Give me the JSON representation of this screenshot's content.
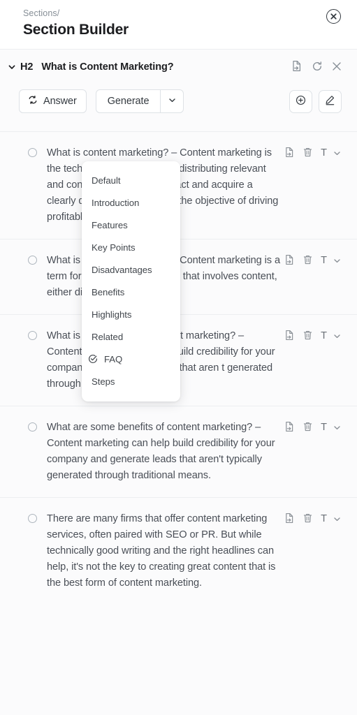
{
  "header": {
    "breadcrumb": "Sections/",
    "title": "Section Builder",
    "close_icon": "close-circle-icon"
  },
  "section": {
    "collapse_icon": "chevron-down-icon",
    "level": "H2",
    "title": "What is Content Marketing?",
    "actions": [
      {
        "icon": "export-document-icon",
        "name": "export-section-button"
      },
      {
        "icon": "refresh-icon",
        "name": "regenerate-section-button"
      },
      {
        "icon": "close-icon",
        "name": "remove-section-button"
      }
    ]
  },
  "toolbar": {
    "answer_label": "Answer",
    "answer_icon": "cycle-refresh-icon",
    "generate_label": "Generate",
    "generate_caret_icon": "chevron-down-icon",
    "add_icon": "plus-circle-icon",
    "edit_icon": "pencil-icon"
  },
  "dropdown": {
    "open": true,
    "selected": "FAQ",
    "check_icon": "check-circle-icon",
    "items": [
      {
        "label": "Default",
        "checked": false
      },
      {
        "label": "Introduction",
        "checked": false
      },
      {
        "label": "Features",
        "checked": false
      },
      {
        "label": "Key Points",
        "checked": false
      },
      {
        "label": "Disadvantages",
        "checked": false
      },
      {
        "label": "Benefits",
        "checked": false
      },
      {
        "label": "Highlights",
        "checked": false
      },
      {
        "label": "Related",
        "checked": false
      },
      {
        "label": "FAQ",
        "checked": true
      },
      {
        "label": "Steps",
        "checked": false
      }
    ]
  },
  "row_actions": {
    "export_icon": "export-document-icon",
    "delete_icon": "trash-icon",
    "text_style_label": "T",
    "text_style_caret_icon": "chevron-down-icon"
  },
  "items": [
    {
      "text": "What is content marketing? – Content marketing is the technique of creating and distributing relevant and consistent content to attract and acquire a clearly defined audience with the objective of driving profitable customer action.",
      "selected": false
    },
    {
      "text": "What is content marketing? – Content marketing is a term for any type of marketing that involves content, either digital or physical.",
      "selected": false
    },
    {
      "text": "What is the purpose of content marketing? – Content marketing can help build credibility for your company and generate leads that aren t generated through traditional methods.",
      "selected": false
    },
    {
      "text": "What are some benefits of content marketing? – Content marketing can help build credibility for your company and generate leads that aren't typically generated through traditional means.",
      "selected": false
    },
    {
      "text": "There are many firms that offer content marketing services, often paired with SEO or PR. But while technically good writing and the right headlines can help, it's not the key to creating great content that is the best form of content marketing.",
      "selected": false
    }
  ],
  "colors": {
    "panel_bg": "#fbfbfc",
    "text": "#4a4f57",
    "muted": "#868e96",
    "border": "#eceef0"
  }
}
